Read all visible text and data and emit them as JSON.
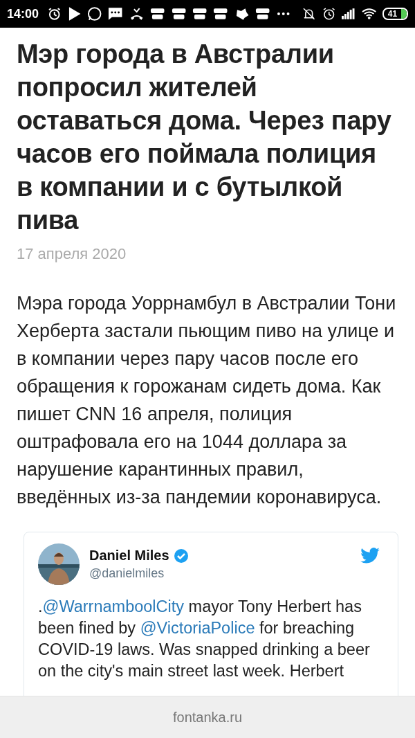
{
  "status_bar": {
    "time": "14:00",
    "battery": "41"
  },
  "article": {
    "title": "Мэр города в Австралии попросил жителей оставаться дома. Через пару часов его поймала полиция в компании и с бутылкой пива",
    "date": "17 апреля 2020",
    "lead": "Мэра города Уоррнамбул в Австралии Тони Херберта застали пьющим пиво на улице и в компании через пару часов после его обращения к горожанам сидеть дома. Как пишет CNN 16 апреля, полиция оштрафовала его на 1044 доллара за нарушение карантинных правил, введённых из-за пандемии коронавируса."
  },
  "tweet": {
    "name": "Daniel Miles",
    "verified": true,
    "handle": "@danielmiles",
    "text": [
      {
        "kind": "text",
        "text": "."
      },
      {
        "kind": "link",
        "text": "@WarrnamboolCity"
      },
      {
        "kind": "text",
        "text": " mayor Tony Herbert has been fined by "
      },
      {
        "kind": "link",
        "text": "@VictoriaPolice"
      },
      {
        "kind": "text",
        "text": " for breaching COVID-19 laws. Was snapped drinking a beer on the city's main street last week. Herbert"
      }
    ]
  },
  "footer": {
    "site": "fontanka.ru"
  }
}
